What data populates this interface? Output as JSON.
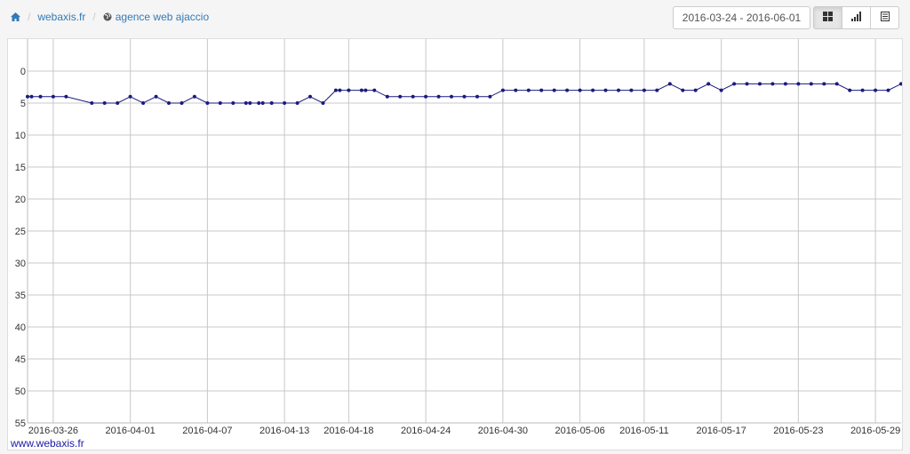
{
  "breadcrumb": {
    "site": "webaxis.fr",
    "keyword": "agence web ajaccio"
  },
  "date_range": "2016-03-24 - 2016-06-01",
  "view_buttons": [
    {
      "icon": "grid-icon",
      "active": true
    },
    {
      "icon": "signal-bars-icon",
      "active": false
    },
    {
      "icon": "list-icon",
      "active": false
    }
  ],
  "watermark": "www.webaxis.fr",
  "chart_data": {
    "type": "line",
    "title": "",
    "xlabel": "",
    "ylabel": "",
    "y_reversed": true,
    "ylim": [
      0,
      55
    ],
    "y_ticks": [
      "0",
      "5",
      "10",
      "15",
      "20",
      "25",
      "30",
      "35",
      "40",
      "45",
      "50",
      "55"
    ],
    "x_ticks": [
      "2016-03-26",
      "2016-04-01",
      "2016-04-07",
      "2016-04-13",
      "2016-04-18",
      "2016-04-24",
      "2016-04-30",
      "2016-05-06",
      "2016-05-11",
      "2016-05-17",
      "2016-05-23",
      "2016-05-29"
    ],
    "grid": true,
    "line_color": "#1a1a80",
    "series": [
      {
        "x": [
          "2016-03-24",
          "2016-03-24",
          "2016-03-25",
          "2016-03-26",
          "2016-03-27",
          "2016-03-29",
          "2016-03-30",
          "2016-03-31",
          "2016-04-01",
          "2016-04-02",
          "2016-04-03",
          "2016-04-04",
          "2016-04-05",
          "2016-04-06",
          "2016-04-07",
          "2016-04-08",
          "2016-04-09",
          "2016-04-10",
          "2016-04-10",
          "2016-04-11",
          "2016-04-11",
          "2016-04-12",
          "2016-04-13",
          "2016-04-14",
          "2016-04-15",
          "2016-04-16",
          "2016-04-17",
          "2016-04-17",
          "2016-04-18",
          "2016-04-19",
          "2016-04-19",
          "2016-04-20",
          "2016-04-21",
          "2016-04-22",
          "2016-04-23",
          "2016-04-24",
          "2016-04-25",
          "2016-04-26",
          "2016-04-27",
          "2016-04-28",
          "2016-04-29",
          "2016-04-30",
          "2016-05-01",
          "2016-05-02",
          "2016-05-03",
          "2016-05-04",
          "2016-05-05",
          "2016-05-06",
          "2016-05-07",
          "2016-05-08",
          "2016-05-09",
          "2016-05-10",
          "2016-05-11",
          "2016-05-12",
          "2016-05-13",
          "2016-05-14",
          "2016-05-15",
          "2016-05-16",
          "2016-05-17",
          "2016-05-18",
          "2016-05-19",
          "2016-05-20",
          "2016-05-21",
          "2016-05-22",
          "2016-05-23",
          "2016-05-24",
          "2016-05-25",
          "2016-05-26",
          "2016-05-27",
          "2016-05-28",
          "2016-05-29",
          "2016-05-30",
          "2016-05-31"
        ],
        "y": [
          4,
          4,
          4,
          4,
          4,
          5,
          5,
          5,
          4,
          5,
          4,
          5,
          5,
          4,
          5,
          5,
          5,
          5,
          5,
          5,
          5,
          5,
          5,
          5,
          4,
          5,
          3,
          3,
          3,
          3,
          3,
          3,
          4,
          4,
          4,
          4,
          4,
          4,
          4,
          4,
          4,
          3,
          3,
          3,
          3,
          3,
          3,
          3,
          3,
          3,
          3,
          3,
          3,
          3,
          2,
          3,
          3,
          2,
          3,
          2,
          2,
          2,
          2,
          2,
          2,
          2,
          2,
          2,
          3,
          3,
          3,
          3,
          2
        ]
      }
    ]
  }
}
